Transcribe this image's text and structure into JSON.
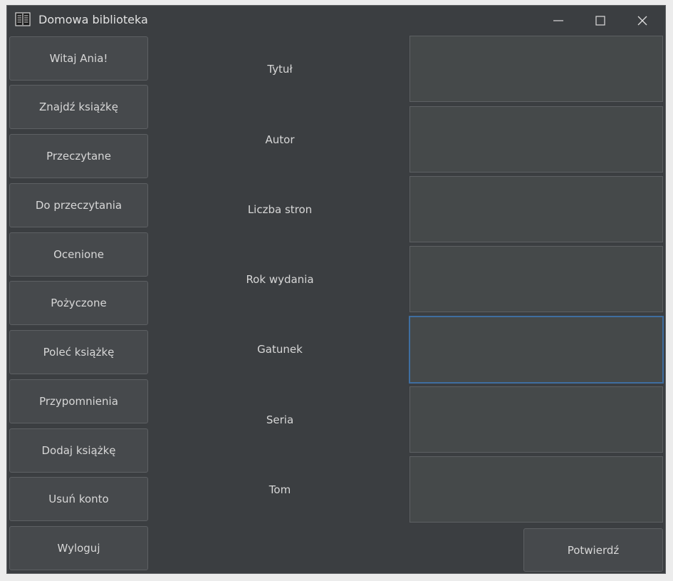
{
  "window": {
    "title": "Domowa biblioteka",
    "app_icon": "open-book-icon",
    "controls": [
      "minimize-icon",
      "maximize-icon",
      "close-icon"
    ]
  },
  "sidebar": {
    "items": [
      {
        "label": "Witaj Ania!"
      },
      {
        "label": "Znajdź książkę"
      },
      {
        "label": "Przeczytane"
      },
      {
        "label": "Do przeczytania"
      },
      {
        "label": "Ocenione"
      },
      {
        "label": "Pożyczone"
      },
      {
        "label": "Poleć książkę"
      },
      {
        "label": "Przypomnienia"
      },
      {
        "label": "Dodaj książkę"
      },
      {
        "label": "Usuń konto"
      },
      {
        "label": "Wyloguj"
      }
    ]
  },
  "form": {
    "fields": [
      {
        "label": "Tytuł",
        "value": ""
      },
      {
        "label": "Autor",
        "value": ""
      },
      {
        "label": "Liczba stron",
        "value": ""
      },
      {
        "label": "Rok wydania",
        "value": ""
      },
      {
        "label": "Gatunek",
        "value": "",
        "focused": true
      },
      {
        "label": "Seria",
        "value": ""
      },
      {
        "label": "Tom",
        "value": ""
      }
    ],
    "confirm_label": "Potwierdź"
  },
  "colors": {
    "background": "#3b3e41",
    "button": "#46494c",
    "input": "#45494a",
    "focus_border": "#3f6ea0",
    "text": "#d7d7d7"
  }
}
